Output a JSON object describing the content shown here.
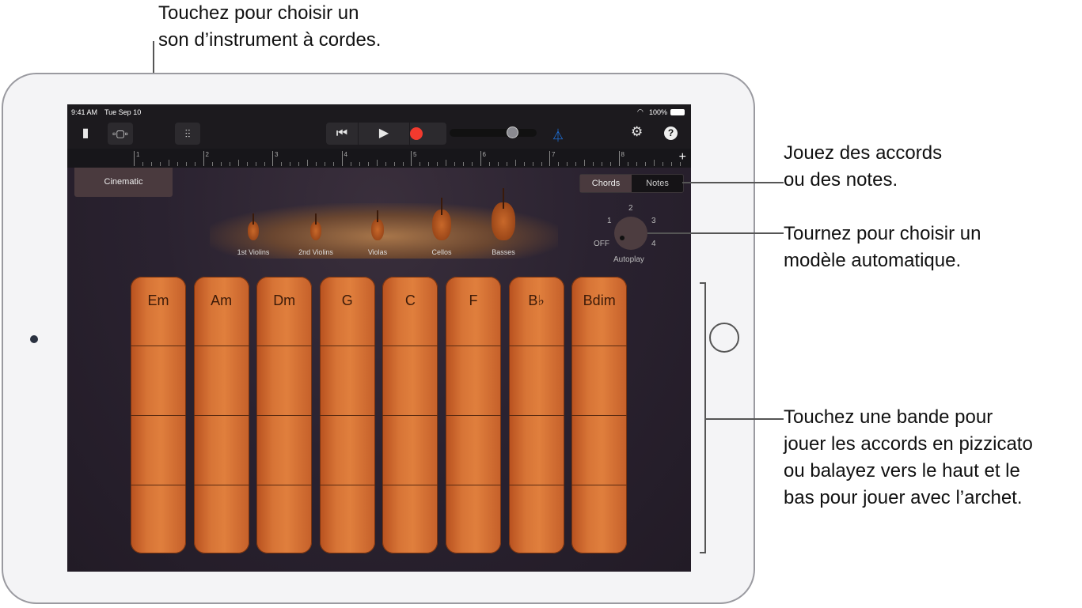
{
  "annotations": {
    "top": [
      "Touchez pour choisir un",
      "son d’instrument à cordes."
    ],
    "chords_notes": [
      "Jouez des accords",
      "ou des notes."
    ],
    "autoplay": [
      "Tournez pour choisir un",
      "modèle automatique."
    ],
    "strips": [
      "Touchez une bande pour",
      "jouer les accords en pizzicato",
      "ou balayez vers le haut et le",
      "bas pour jouer avec l’archet."
    ]
  },
  "status": {
    "time": "9:41 AM",
    "date": "Tue Sep 10",
    "battery": "100%"
  },
  "toolbar": {
    "icons": [
      "document-icon",
      "tracks-view-icon",
      "mixer-icon",
      "rewind-icon",
      "play-icon",
      "record-icon",
      "metronome-icon",
      "settings-icon",
      "help-icon"
    ],
    "help": "?",
    "volume": 0.72,
    "accent": "#1e7cf2",
    "record_color": "#f23a2e"
  },
  "ruler": {
    "bars": [
      "1",
      "2",
      "3",
      "4",
      "5",
      "6",
      "7",
      "8"
    ],
    "add": "+"
  },
  "preset": "Cinematic",
  "mode": {
    "options": [
      "Chords",
      "Notes"
    ],
    "selected": "Chords"
  },
  "instruments": [
    "1st Violins",
    "2nd Violins",
    "Violas",
    "Cellos",
    "Basses"
  ],
  "autoplay": {
    "label": "Autoplay",
    "positions": [
      "OFF",
      "1",
      "2",
      "3",
      "4"
    ],
    "selected": "OFF"
  },
  "chords": [
    "Em",
    "Am",
    "Dm",
    "G",
    "C",
    "F",
    "B♭",
    "Bdim"
  ]
}
